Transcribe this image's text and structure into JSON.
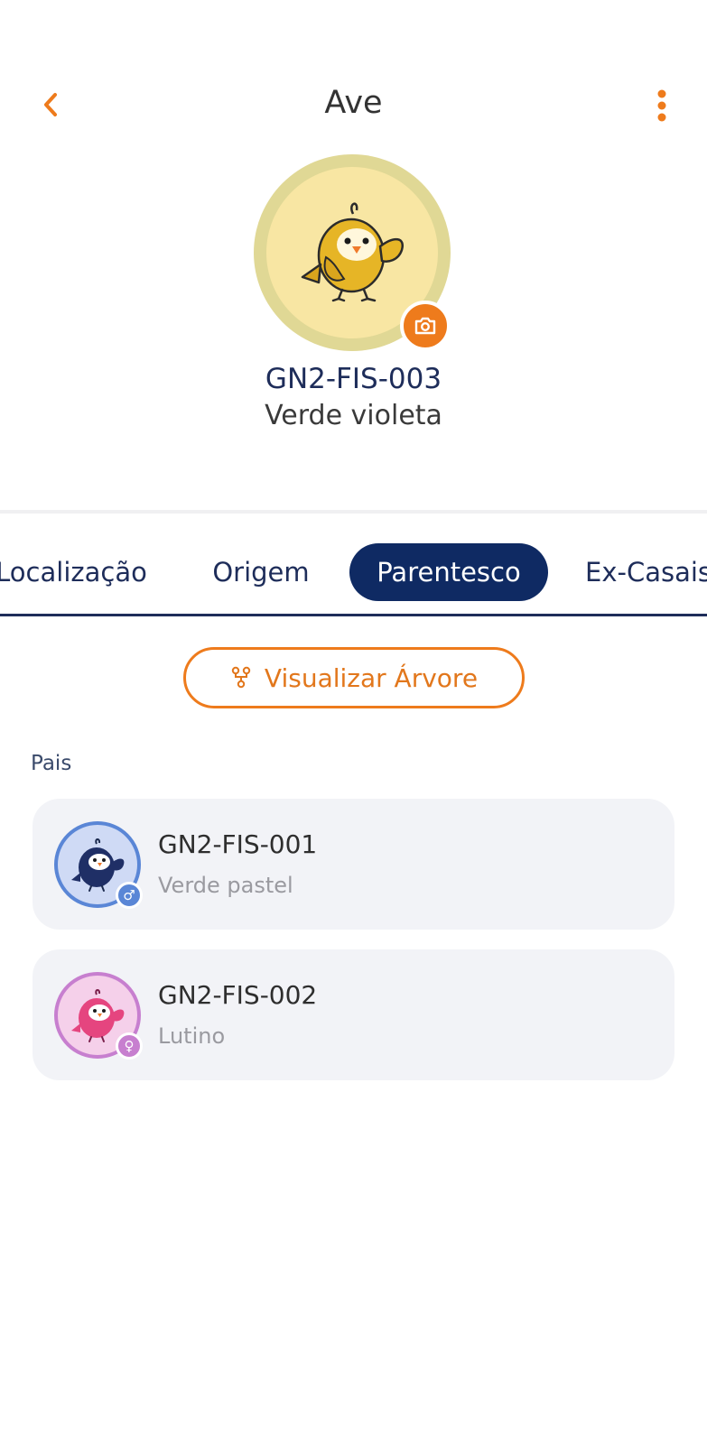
{
  "header": {
    "title": "Ave",
    "back_icon": "chevron-left-icon",
    "menu_icon": "more-vertical-icon",
    "accent_color": "#ee7b1c"
  },
  "profile": {
    "code": "GN2-FIS-003",
    "color_name": "Verde violeta",
    "avatar_icon": "yellow-bird-icon",
    "camera_icon": "camera-icon"
  },
  "tabs": [
    {
      "label": "Localização",
      "active": false
    },
    {
      "label": "Origem",
      "active": false
    },
    {
      "label": "Parentesco",
      "active": true
    },
    {
      "label": "Ex-Casais",
      "active": false
    }
  ],
  "tree_button": {
    "label": "Visualizar Árvore",
    "icon": "tree-icon"
  },
  "parents": {
    "section_label": "Pais",
    "items": [
      {
        "code": "GN2-FIS-001",
        "color_name": "Verde pastel",
        "sex": "male",
        "sex_symbol": "♂",
        "avatar_icon": "blue-bird-icon"
      },
      {
        "code": "GN2-FIS-002",
        "color_name": "Lutino",
        "sex": "female",
        "sex_symbol": "♀",
        "avatar_icon": "pink-bird-icon"
      }
    ]
  },
  "colors": {
    "primary_navy": "#0f2a63",
    "accent_orange": "#ee7b1c",
    "card_bg": "#f2f3f7",
    "male_blue": "#5a86d6",
    "female_pink": "#c77fcf"
  }
}
